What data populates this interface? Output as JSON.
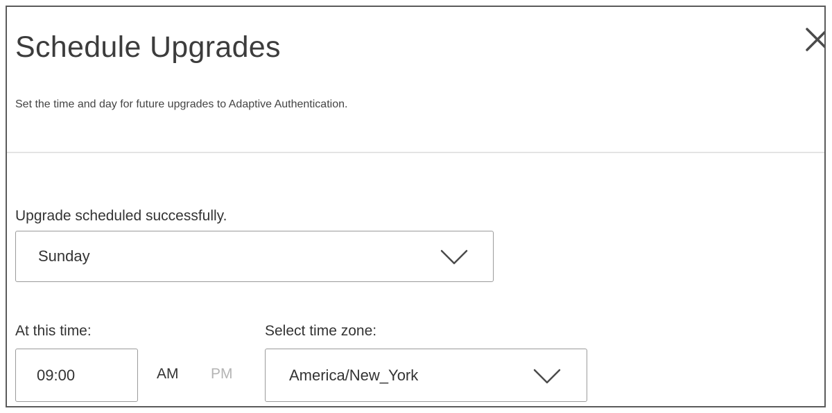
{
  "dialog": {
    "title": "Schedule Upgrades",
    "description": "Set the time and day for future upgrades to Adaptive Authentication.",
    "close_icon": "close-icon"
  },
  "form": {
    "status_message": "Upgrade scheduled successfully.",
    "day_select": {
      "value": "Sunday",
      "icon": "chevron-down-icon"
    },
    "time_label": "At this time:",
    "time_value": "09:00",
    "am_label": "AM",
    "pm_label": "PM",
    "selected_period": "AM",
    "timezone_label": "Select time zone:",
    "timezone_select": {
      "value": "America/New_York",
      "icon": "chevron-down-icon"
    }
  },
  "colors": {
    "text": "#333333",
    "border": "#9a9a9a",
    "inactive_text": "#b4b4b4",
    "divider": "#e4e4e4"
  }
}
